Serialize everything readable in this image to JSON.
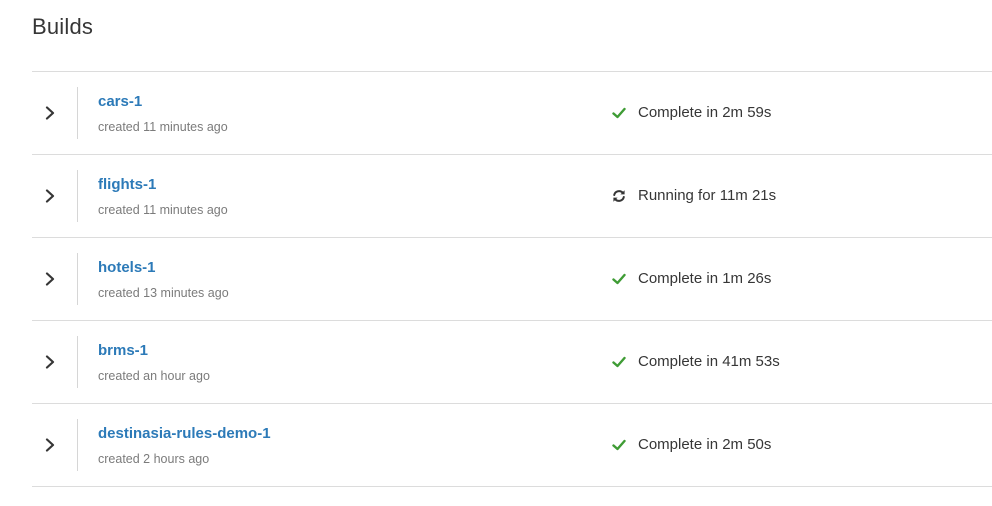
{
  "page": {
    "title": "Builds"
  },
  "colors": {
    "link": "#2c7ab8",
    "success": "#3f9c35",
    "running": "#363636",
    "muted": "#7b7b7b",
    "divider": "#dcdcdc"
  },
  "builds": [
    {
      "name": "cars-1",
      "created": "created 11 minutes ago",
      "status": "complete",
      "status_icon": "check-icon",
      "status_text": "Complete in 2m 59s"
    },
    {
      "name": "flights-1",
      "created": "created 11 minutes ago",
      "status": "running",
      "status_icon": "refresh-icon",
      "status_text": "Running for 11m 21s"
    },
    {
      "name": "hotels-1",
      "created": "created 13 minutes ago",
      "status": "complete",
      "status_icon": "check-icon",
      "status_text": "Complete in 1m 26s"
    },
    {
      "name": "brms-1",
      "created": "created an hour ago",
      "status": "complete",
      "status_icon": "check-icon",
      "status_text": "Complete in 41m 53s"
    },
    {
      "name": "destinasia-rules-demo-1",
      "created": "created 2 hours ago",
      "status": "complete",
      "status_icon": "check-icon",
      "status_text": "Complete in 2m 50s"
    }
  ]
}
